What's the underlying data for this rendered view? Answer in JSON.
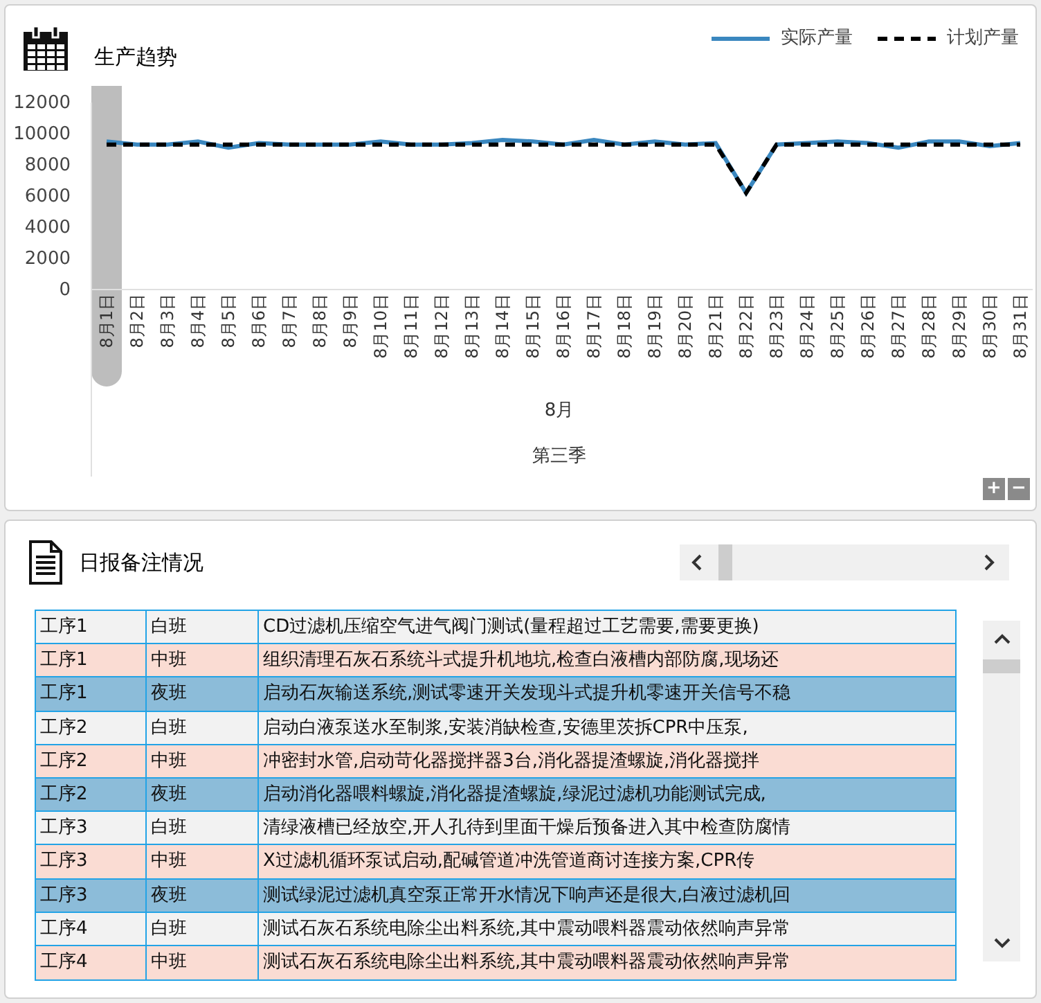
{
  "trend_panel": {
    "title": "生产趋势",
    "chart_data": {
      "type": "line",
      "categories": [
        "8月1日",
        "8月2日",
        "8月3日",
        "8月4日",
        "8月5日",
        "8月6日",
        "8月7日",
        "8月8日",
        "8月9日",
        "8月10日",
        "8月11日",
        "8月12日",
        "8月13日",
        "8月14日",
        "8月15日",
        "8月16日",
        "8月17日",
        "8月18日",
        "8月19日",
        "8月20日",
        "8月21日",
        "8月22日",
        "8月23日",
        "8月24日",
        "8月25日",
        "8月26日",
        "8月27日",
        "8月28日",
        "8月29日",
        "8月30日",
        "8月31日"
      ],
      "xlabel": "8月",
      "ylim": [
        0,
        12000
      ],
      "yticks": [
        0,
        2000,
        4000,
        6000,
        8000,
        10000,
        12000
      ],
      "series": [
        {
          "name": "实际产量",
          "color": "#3a87bf",
          "line_style": "solid",
          "values": [
            9500,
            9300,
            9300,
            9500,
            9100,
            9400,
            9300,
            9300,
            9300,
            9500,
            9300,
            9300,
            9400,
            9600,
            9500,
            9300,
            9600,
            9300,
            9500,
            9300,
            9400,
            6200,
            9300,
            9400,
            9500,
            9400,
            9100,
            9500,
            9500,
            9200,
            9400
          ]
        },
        {
          "name": "计划产量",
          "color": "#000000",
          "line_style": "dashed",
          "values": [
            9300,
            9300,
            9300,
            9300,
            9300,
            9300,
            9300,
            9300,
            9300,
            9300,
            9300,
            9300,
            9300,
            9300,
            9300,
            9300,
            9300,
            9300,
            9300,
            9300,
            9300,
            6200,
            9300,
            9300,
            9300,
            9300,
            9300,
            9300,
            9300,
            9300,
            9300
          ]
        }
      ]
    },
    "group_label": "第三季",
    "zoom_buttons": [
      "+",
      "−"
    ]
  },
  "notes_panel": {
    "title": "日报备注情况",
    "rows": [
      {
        "process": "工序1",
        "shift": "白班",
        "note": "CD过滤机压缩空气进气阀门测试(量程超过工艺需要,需要更换)",
        "color": "#f2f2f2"
      },
      {
        "process": "工序1",
        "shift": "中班",
        "note": "组织清理石灰石系统斗式提升机地坑,检查白液槽内部防腐,现场还",
        "color": "#fadcd3"
      },
      {
        "process": "工序1",
        "shift": "夜班",
        "note": "启动石灰输送系统,测试零速开关发现斗式提升机零速开关信号不稳",
        "color": "#8cbcd9"
      },
      {
        "process": "工序2",
        "shift": "白班",
        "note": "启动白液泵送水至制浆,安装消缺检查,安德里茨拆CPR中压泵,",
        "color": "#f2f2f2"
      },
      {
        "process": "工序2",
        "shift": "中班",
        "note": "冲密封水管,启动苛化器搅拌器3台,消化器提渣螺旋,消化器搅拌",
        "color": "#fadcd3"
      },
      {
        "process": "工序2",
        "shift": "夜班",
        "note": "启动消化器喂料螺旋,消化器提渣螺旋,绿泥过滤机功能测试完成,",
        "color": "#8cbcd9"
      },
      {
        "process": "工序3",
        "shift": "白班",
        "note": "清绿液槽已经放空,开人孔待到里面干燥后预备进入其中检查防腐情",
        "color": "#f2f2f2"
      },
      {
        "process": "工序3",
        "shift": "中班",
        "note": "X过滤机循环泵试启动,配碱管道冲洗管道商讨连接方案,CPR传",
        "color": "#fadcd3"
      },
      {
        "process": "工序3",
        "shift": "夜班",
        "note": "测试绿泥过滤机真空泵正常开水情况下响声还是很大,白液过滤机回",
        "color": "#8cbcd9"
      },
      {
        "process": "工序4",
        "shift": "白班",
        "note": "测试石灰石系统电除尘出料系统,其中震动喂料器震动依然响声异常",
        "color": "#f2f2f2"
      },
      {
        "process": "工序4",
        "shift": "中班",
        "note": "测试石灰石系统电除尘出料系统,其中震动喂料器震动依然响声异常",
        "color": "#fadcd3"
      }
    ]
  }
}
